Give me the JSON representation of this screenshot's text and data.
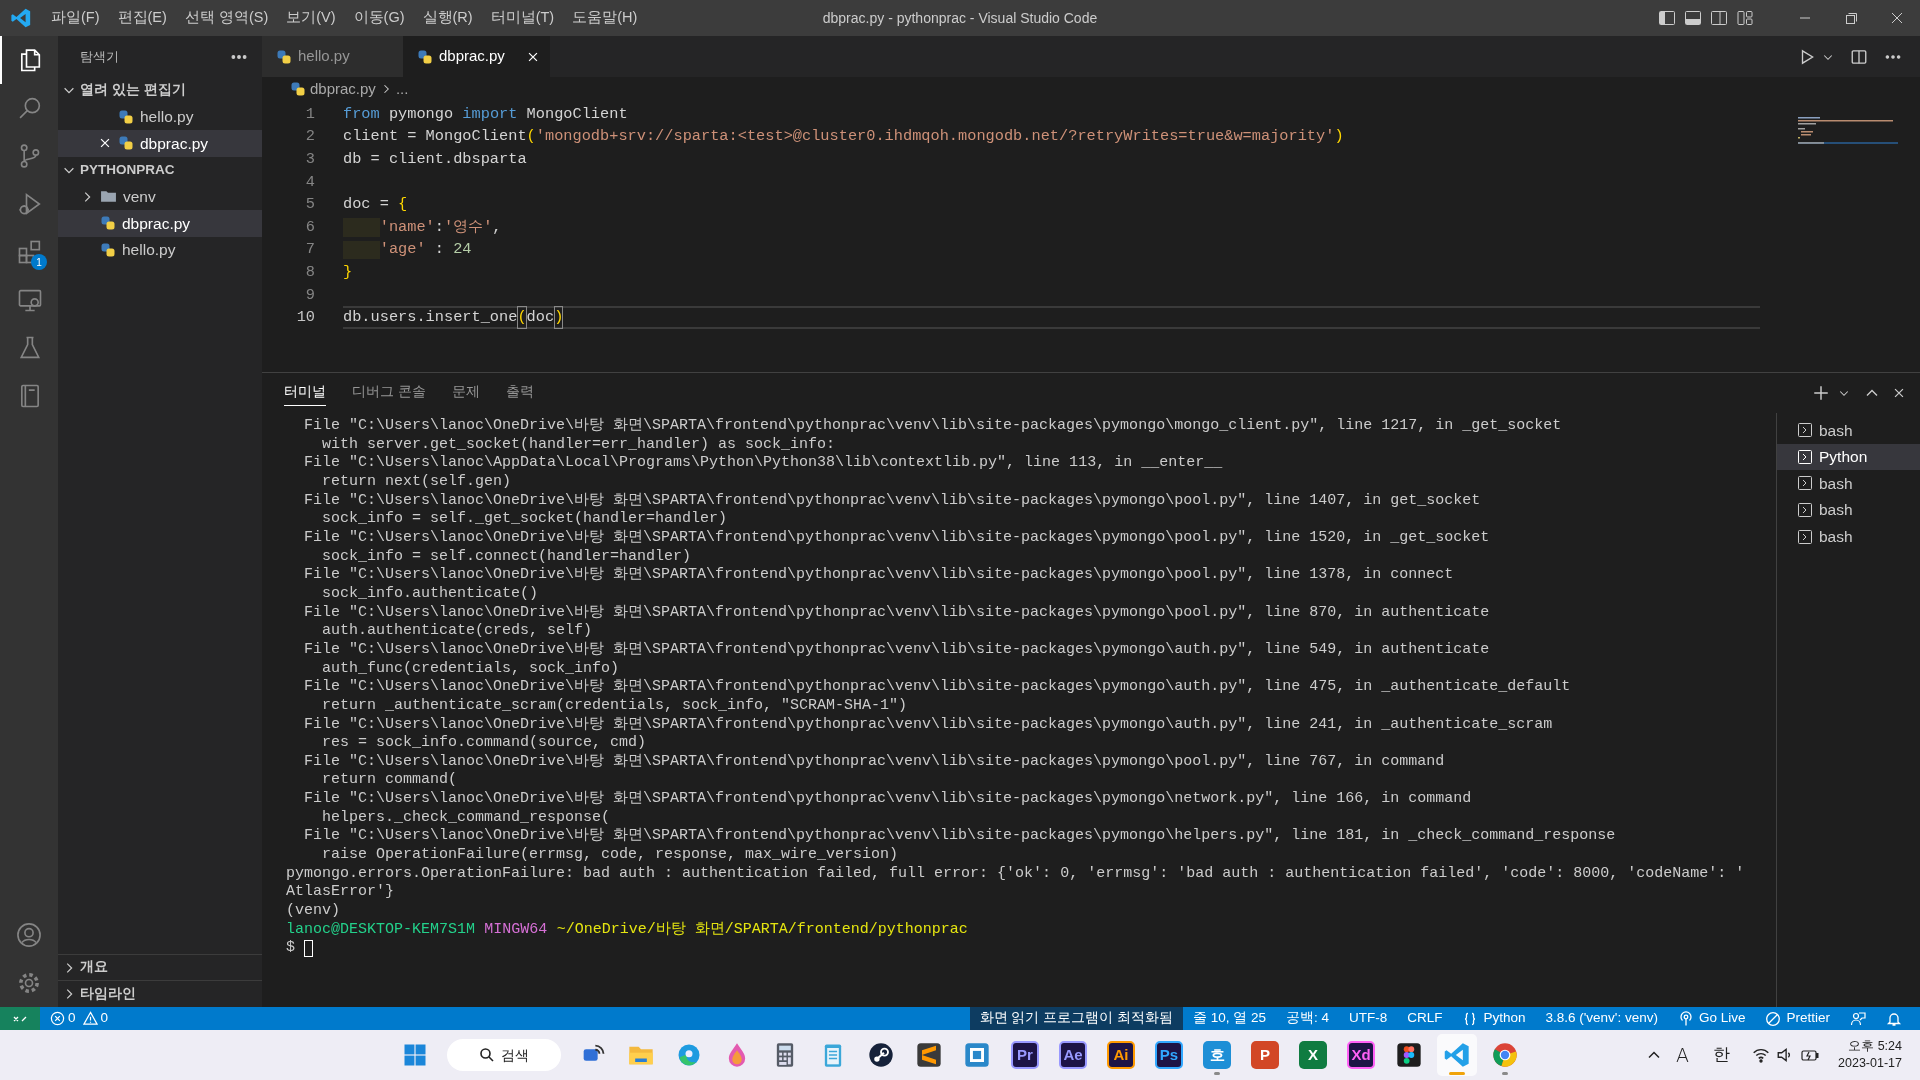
{
  "window": {
    "title": "dbprac.py - pythonprac - Visual Studio Code"
  },
  "menu": [
    "파일(F)",
    "편집(E)",
    "선택 영역(S)",
    "보기(V)",
    "이동(G)",
    "실행(R)",
    "터미널(T)",
    "도움말(H)"
  ],
  "activity_bar": {
    "items": [
      {
        "kind": "files",
        "selected": true
      },
      {
        "kind": "search",
        "selected": false
      },
      {
        "kind": "source-control",
        "selected": false
      },
      {
        "kind": "run-debug",
        "selected": false
      },
      {
        "kind": "extensions",
        "selected": false,
        "badge": "1"
      },
      {
        "kind": "remote",
        "selected": false
      },
      {
        "kind": "testing",
        "selected": false
      },
      {
        "kind": "book",
        "selected": false
      }
    ],
    "bottom": [
      {
        "kind": "account"
      },
      {
        "kind": "settings"
      }
    ]
  },
  "sidebar": {
    "title": "탐색기",
    "sections": [
      {
        "title": "열려 있는 편집기",
        "expanded": true,
        "items": [
          {
            "label": "hello.py",
            "kind": "python",
            "selected": false,
            "closable": false
          },
          {
            "label": "dbprac.py",
            "kind": "python",
            "selected": true,
            "closable": true
          }
        ]
      },
      {
        "title": "PYTHONPRAC",
        "expanded": true,
        "items": [
          {
            "label": "venv",
            "kind": "folder",
            "selected": false,
            "expanded": false
          },
          {
            "label": "dbprac.py",
            "kind": "python",
            "selected": true
          },
          {
            "label": "hello.py",
            "kind": "python",
            "selected": false
          }
        ]
      }
    ],
    "bottom_sections": [
      {
        "title": "개요",
        "expanded": false
      },
      {
        "title": "타임라인",
        "expanded": false
      }
    ]
  },
  "editor": {
    "tabs": [
      {
        "label": "hello.py",
        "selected": false
      },
      {
        "label": "dbprac.py",
        "selected": true
      }
    ],
    "breadcrumb": [
      "dbprac.py",
      "..."
    ],
    "lines": [
      {
        "number": "1",
        "current": false,
        "indented": false,
        "tokens": [
          {
            "kind": "keyword",
            "text": "from"
          },
          {
            "kind": "plain",
            "text": " pymongo "
          },
          {
            "kind": "keyword",
            "text": "import"
          },
          {
            "kind": "plain",
            "text": " MongoClient"
          }
        ]
      },
      {
        "number": "2",
        "current": false,
        "indented": false,
        "tokens": [
          {
            "kind": "plain",
            "text": "client = MongoClient"
          },
          {
            "kind": "bracket",
            "text": "("
          },
          {
            "kind": "string",
            "text": "'mongodb+srv://sparta:<test>@cluster0.ihdmqoh.mongodb.net/?retryWrites=true&w=majority'"
          },
          {
            "kind": "bracket",
            "text": ")"
          }
        ]
      },
      {
        "number": "3",
        "current": false,
        "indented": false,
        "tokens": [
          {
            "kind": "plain",
            "text": "db = client.dbsparta"
          }
        ]
      },
      {
        "number": "4",
        "current": false,
        "indented": false
      },
      {
        "number": "5",
        "current": false,
        "indented": false,
        "tokens": [
          {
            "kind": "plain",
            "text": "doc = "
          },
          {
            "kind": "bracket",
            "text": "{"
          }
        ]
      },
      {
        "number": "6",
        "current": false,
        "indented": true,
        "tokens": [
          {
            "kind": "string",
            "text": "'name'"
          },
          {
            "kind": "plain",
            "text": ":"
          },
          {
            "kind": "string",
            "text": "'영수'"
          },
          {
            "kind": "plain",
            "text": ","
          }
        ]
      },
      {
        "number": "7",
        "current": false,
        "indented": true,
        "tokens": [
          {
            "kind": "string",
            "text": "'age'"
          },
          {
            "kind": "plain",
            "text": " : "
          },
          {
            "kind": "number",
            "text": "24"
          }
        ]
      },
      {
        "number": "8",
        "current": false,
        "indented": false,
        "tokens": [
          {
            "kind": "bracket",
            "text": "}"
          }
        ]
      },
      {
        "number": "9",
        "current": false,
        "indented": false
      },
      {
        "number": "10",
        "current": true,
        "indented": false,
        "tokens": [
          {
            "kind": "plain",
            "text": "db.users.insert_one"
          },
          {
            "kind": "bracket-match",
            "text": "("
          },
          {
            "kind": "plain",
            "text": "doc"
          },
          {
            "kind": "bracket-match",
            "text": ")"
          }
        ]
      }
    ]
  },
  "panel": {
    "tabs": [
      {
        "label": "터미널",
        "selected": true
      },
      {
        "label": "디버그 콘솔",
        "selected": false
      },
      {
        "label": "문제",
        "selected": false
      },
      {
        "label": "출력",
        "selected": false
      }
    ],
    "terminal_lines": [
      {
        "kind": "frame",
        "text": "File \"C:\\Users\\lanoc\\OneDrive\\바탕 화면\\SPARTA\\frontend\\pythonprac\\venv\\lib\\site-packages\\pymongo\\mongo_client.py\", line 1217, in _get_socket"
      },
      {
        "kind": "source",
        "text": "with server.get_socket(handler=err_handler) as sock_info:"
      },
      {
        "kind": "frame",
        "text": "File \"C:\\Users\\lanoc\\AppData\\Local\\Programs\\Python\\Python38\\lib\\contextlib.py\", line 113, in __enter__"
      },
      {
        "kind": "source",
        "text": "return next(self.gen)"
      },
      {
        "kind": "frame",
        "text": "File \"C:\\Users\\lanoc\\OneDrive\\바탕 화면\\SPARTA\\frontend\\pythonprac\\venv\\lib\\site-packages\\pymongo\\pool.py\", line 1407, in get_socket"
      },
      {
        "kind": "source",
        "text": "sock_info = self._get_socket(handler=handler)"
      },
      {
        "kind": "frame",
        "text": "File \"C:\\Users\\lanoc\\OneDrive\\바탕 화면\\SPARTA\\frontend\\pythonprac\\venv\\lib\\site-packages\\pymongo\\pool.py\", line 1520, in _get_socket"
      },
      {
        "kind": "source",
        "text": "sock_info = self.connect(handler=handler)"
      },
      {
        "kind": "frame",
        "text": "File \"C:\\Users\\lanoc\\OneDrive\\바탕 화면\\SPARTA\\frontend\\pythonprac\\venv\\lib\\site-packages\\pymongo\\pool.py\", line 1378, in connect"
      },
      {
        "kind": "source",
        "text": "sock_info.authenticate()"
      },
      {
        "kind": "frame",
        "text": "File \"C:\\Users\\lanoc\\OneDrive\\바탕 화면\\SPARTA\\frontend\\pythonprac\\venv\\lib\\site-packages\\pymongo\\pool.py\", line 870, in authenticate"
      },
      {
        "kind": "source",
        "text": "auth.authenticate(creds, self)"
      },
      {
        "kind": "frame",
        "text": "File \"C:\\Users\\lanoc\\OneDrive\\바탕 화면\\SPARTA\\frontend\\pythonprac\\venv\\lib\\site-packages\\pymongo\\auth.py\", line 549, in authenticate"
      },
      {
        "kind": "source",
        "text": "auth_func(credentials, sock_info)"
      },
      {
        "kind": "frame",
        "text": "File \"C:\\Users\\lanoc\\OneDrive\\바탕 화면\\SPARTA\\frontend\\pythonprac\\venv\\lib\\site-packages\\pymongo\\auth.py\", line 475, in _authenticate_default"
      },
      {
        "kind": "source",
        "text": "return _authenticate_scram(credentials, sock_info, \"SCRAM-SHA-1\")"
      },
      {
        "kind": "frame",
        "text": "File \"C:\\Users\\lanoc\\OneDrive\\바탕 화면\\SPARTA\\frontend\\pythonprac\\venv\\lib\\site-packages\\pymongo\\auth.py\", line 241, in _authenticate_scram"
      },
      {
        "kind": "source",
        "text": "res = sock_info.command(source, cmd)"
      },
      {
        "kind": "frame",
        "text": "File \"C:\\Users\\lanoc\\OneDrive\\바탕 화면\\SPARTA\\frontend\\pythonprac\\venv\\lib\\site-packages\\pymongo\\pool.py\", line 767, in command"
      },
      {
        "kind": "source",
        "text": "return command("
      },
      {
        "kind": "frame",
        "text": "File \"C:\\Users\\lanoc\\OneDrive\\바탕 화면\\SPARTA\\frontend\\pythonprac\\venv\\lib\\site-packages\\pymongo\\network.py\", line 166, in command"
      },
      {
        "kind": "source",
        "text": "helpers._check_command_response("
      },
      {
        "kind": "frame",
        "text": "File \"C:\\Users\\lanoc\\OneDrive\\바탕 화면\\SPARTA\\frontend\\pythonprac\\venv\\lib\\site-packages\\pymongo\\helpers.py\", line 181, in _check_command_response"
      },
      {
        "kind": "source",
        "text": "raise OperationFailure(errmsg, code, response, max_wire_version)"
      },
      {
        "kind": "plain",
        "text": "pymongo.errors.OperationFailure: bad auth : authentication failed, full error: {'ok': 0, 'errmsg': 'bad auth : authentication failed', 'code': 8000, 'codeName': '"
      },
      {
        "kind": "plain",
        "text": "AtlasError'}"
      },
      {
        "kind": "plain",
        "text": "(venv)"
      },
      {
        "kind": "prompt",
        "parts": [
          {
            "kind": "user",
            "text": "lanoc@DESKTOP-KEM7S1M"
          },
          {
            "kind": "system",
            "text": "MINGW64"
          },
          {
            "kind": "path",
            "text": "~/OneDrive/바탕 화면/SPARTA/frontend/pythonprac"
          }
        ]
      },
      {
        "kind": "input",
        "text": "$"
      }
    ],
    "terminals": [
      {
        "label": "bash",
        "selected": false
      },
      {
        "label": "Python",
        "selected": true
      },
      {
        "label": "bash",
        "selected": false
      },
      {
        "label": "bash",
        "selected": false
      },
      {
        "label": "bash",
        "selected": false
      }
    ]
  },
  "status_bar": {
    "errors": "0",
    "warnings": "0",
    "items": [
      {
        "kind": "highlight",
        "text": "화면 읽기 프로그램이 최적화됨"
      },
      {
        "kind": "text",
        "text": "줄 10, 열 25"
      },
      {
        "kind": "text",
        "text": "공백: 4"
      },
      {
        "kind": "text",
        "text": "UTF-8"
      },
      {
        "kind": "text",
        "text": "CRLF"
      },
      {
        "kind": "braces",
        "text": "Python"
      },
      {
        "kind": "text",
        "text": "3.8.6 ('venv': venv)"
      },
      {
        "kind": "broadcast",
        "text": "Go Live"
      },
      {
        "kind": "prohibit",
        "text": "Prettier"
      },
      {
        "kind": "feedback"
      },
      {
        "kind": "bell"
      }
    ]
  },
  "taskbar": {
    "search": "검색",
    "apps": [
      {
        "kind": "start",
        "running": false,
        "active": false
      },
      {
        "kind": "search"
      },
      {
        "kind": "cast",
        "running": false,
        "active": false
      },
      {
        "kind": "folder",
        "running": false,
        "active": false
      },
      {
        "kind": "edge",
        "running": false,
        "active": false
      },
      {
        "kind": "drop",
        "running": false,
        "active": false
      },
      {
        "kind": "calculator",
        "running": false,
        "active": false
      },
      {
        "kind": "notepad",
        "running": false,
        "active": false
      },
      {
        "kind": "steam",
        "running": false,
        "active": false
      },
      {
        "kind": "sublime",
        "running": false,
        "active": false
      },
      {
        "kind": "brackets",
        "running": false,
        "active": false
      },
      {
        "kind": "adobe",
        "label": "Pr",
        "color": "#9999ff",
        "running": false,
        "active": false
      },
      {
        "kind": "adobe",
        "label": "Ae",
        "color": "#9999ff",
        "running": false,
        "active": false
      },
      {
        "kind": "adobe",
        "label": "Ai",
        "color": "#ff9a00",
        "running": false,
        "active": false
      },
      {
        "kind": "adobe",
        "label": "Ps",
        "color": "#31a8ff",
        "running": false,
        "active": false
      },
      {
        "kind": "office",
        "label": "호",
        "color": "#1e8fd6",
        "running": true,
        "active": false
      },
      {
        "kind": "office",
        "label": "P",
        "color": "#d24726",
        "running": false,
        "active": false
      },
      {
        "kind": "office",
        "label": "X",
        "color": "#107c41",
        "running": false,
        "active": false
      },
      {
        "kind": "adobe",
        "label": "Xd",
        "color": "#ff61f6",
        "running": false,
        "active": false
      },
      {
        "kind": "figma",
        "running": false,
        "active": false
      },
      {
        "kind": "vscode",
        "running": true,
        "active": true
      },
      {
        "kind": "chrome",
        "running": true,
        "active": false
      }
    ],
    "tray": {
      "ime_mode": "A",
      "ime_lang": "한",
      "time": "오후 5:24",
      "date": "2023-01-17"
    }
  }
}
